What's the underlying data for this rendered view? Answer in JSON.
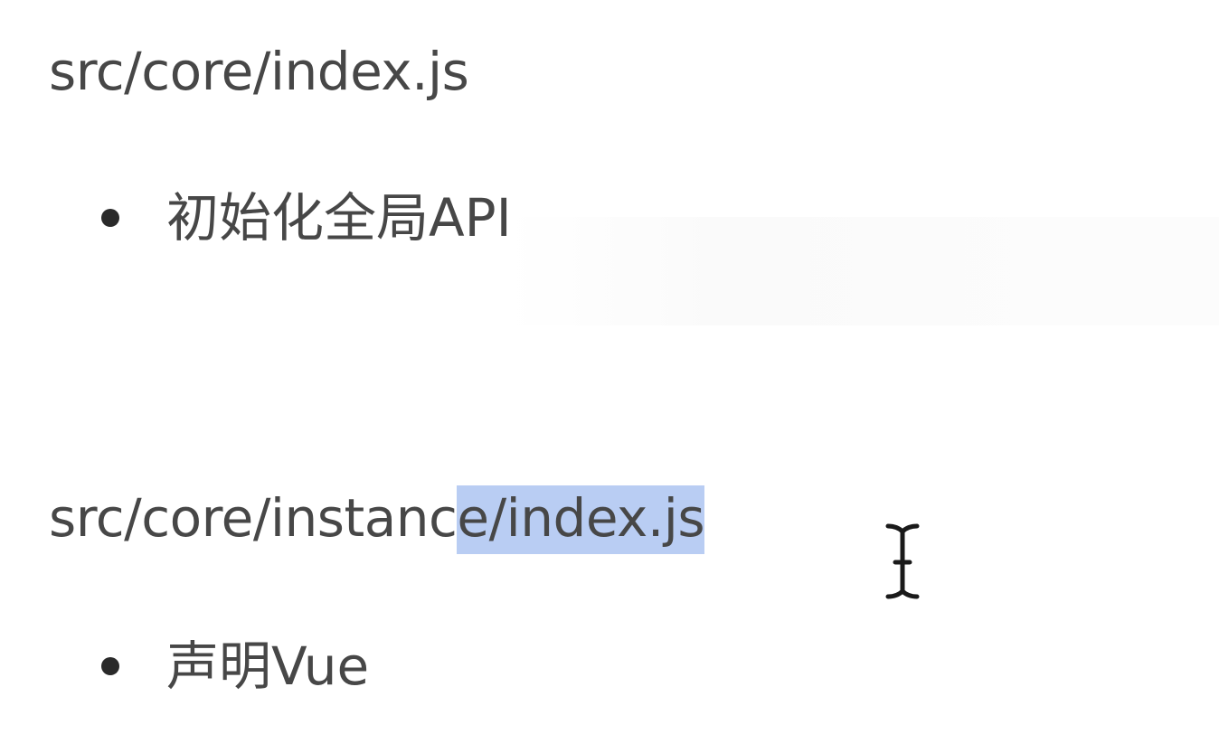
{
  "document": {
    "sections": [
      {
        "path": "src/core/index.js",
        "bullets": [
          "初始化全局API"
        ]
      },
      {
        "path_unselected": "src/core/instanc",
        "path_selected": "e/index.js",
        "bullets": [
          "声明Vue"
        ]
      }
    ]
  },
  "cursor": {
    "icon": "text-cursor-icon"
  },
  "colors": {
    "text": "#474747",
    "selection": "#b9cdf3",
    "bullet": "#2a2a2a",
    "background": "#ffffff"
  }
}
